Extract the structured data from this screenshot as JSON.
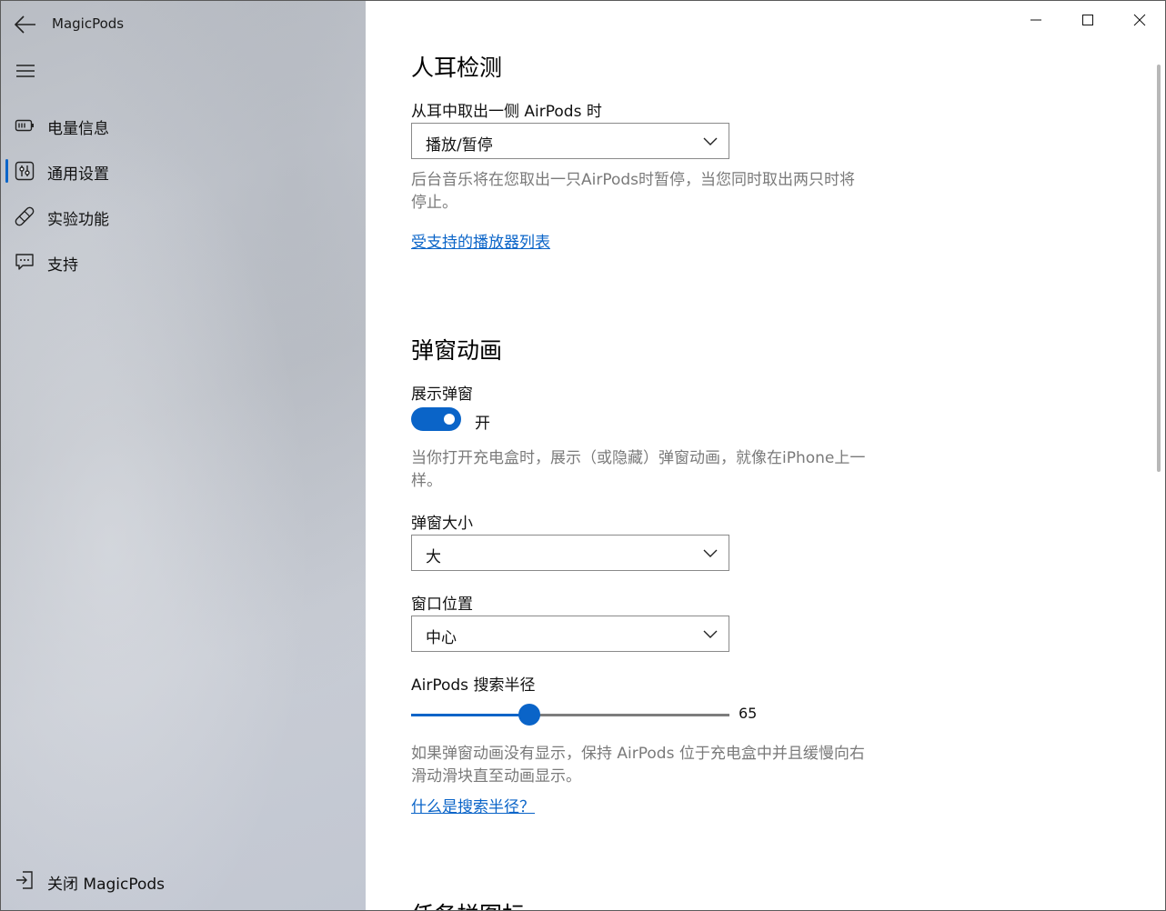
{
  "app": {
    "title": "MagicPods"
  },
  "sidebar": {
    "items": [
      {
        "label": "电量信息",
        "icon": "battery-icon",
        "selected": false
      },
      {
        "label": "通用设置",
        "icon": "settings-sliders-icon",
        "selected": true
      },
      {
        "label": "实验功能",
        "icon": "bandage-icon",
        "selected": false
      },
      {
        "label": "支持",
        "icon": "chat-bubble-icon",
        "selected": false
      }
    ],
    "footer": {
      "label": "关闭 MagicPods",
      "icon": "exit-icon"
    }
  },
  "ear_detection": {
    "title": "人耳检测",
    "remove_label": "从耳中取出一侧 AirPods 时",
    "remove_value": "播放/暂停",
    "description": "后台音乐将在您取出一只AirPods时暂停，当您同时取出两只时将停止。",
    "supported_players_link": "受支持的播放器列表"
  },
  "popup_animation": {
    "title": "弹窗动画",
    "show_label": "展示弹窗",
    "show_state": "开",
    "show_on": true,
    "description": "当你打开充电盒时，展示（或隐藏）弹窗动画，就像在iPhone上一样。",
    "size_label": "弹窗大小",
    "size_value": "大",
    "position_label": "窗口位置",
    "position_value": "中心",
    "radius_label": "AirPods 搜索半径",
    "radius_value": "65",
    "radius_fraction": 0.37,
    "radius_description": "如果弹窗动画没有显示，保持 AirPods 位于充电盒中并且缓慢向右滑动滑块直至动画显示。",
    "radius_link": "什么是搜索半径？"
  },
  "taskbar_icon": {
    "title": "任务栏图标"
  },
  "colors": {
    "accent": "#0a64c8",
    "description_text": "#7a7a7a"
  }
}
